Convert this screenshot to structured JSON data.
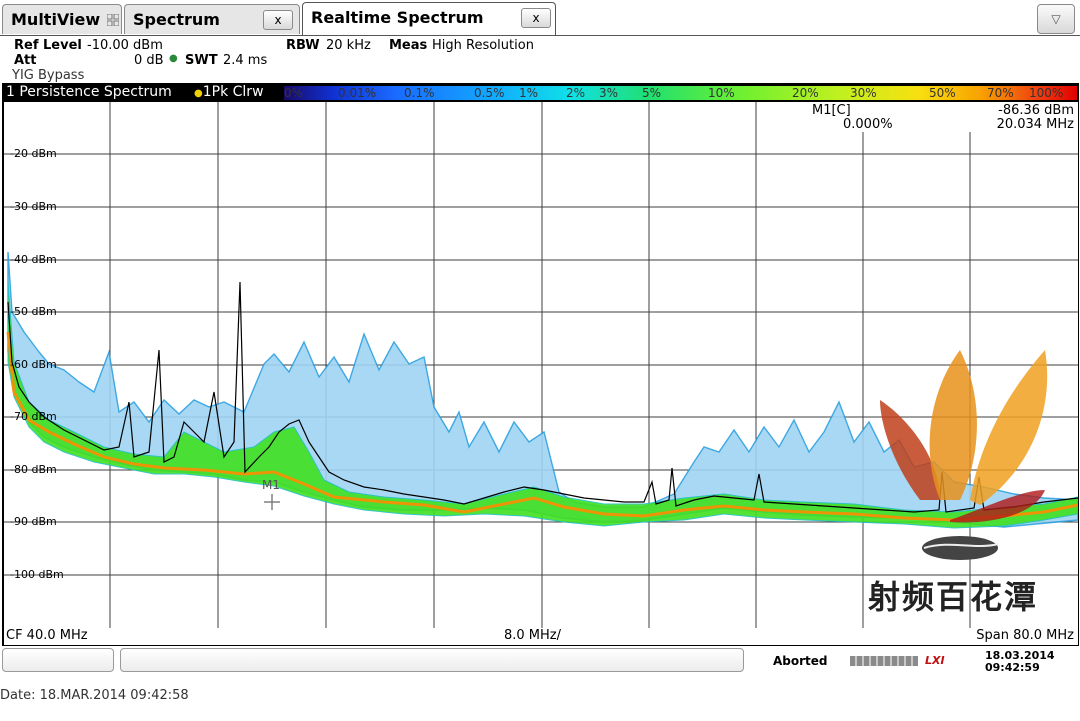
{
  "tabs": [
    {
      "label": "MultiView"
    },
    {
      "label": "Spectrum",
      "close": "x"
    },
    {
      "label": "Realtime Spectrum",
      "close": "x"
    }
  ],
  "settings": {
    "ref_level_label": "Ref Level",
    "ref_level_value": "-10.00 dBm",
    "att_label": "Att",
    "att_value": "0 dB",
    "swt_label": "SWT",
    "swt_value": "2.4 ms",
    "rbw_label": "RBW",
    "rbw_value": "20 kHz",
    "meas_label": "Meas",
    "meas_value": "High Resolution",
    "yig": "YIG Bypass"
  },
  "window": {
    "title": "1 Persistence Spectrum",
    "trace": "1Pk Clrw"
  },
  "colorbar_labels": [
    "0%",
    "0.01%",
    "0.1%",
    "0.5%",
    "1%",
    "2%",
    "3%",
    "5%",
    "10%",
    "20%",
    "30%",
    "50%",
    "70%",
    "100%"
  ],
  "y_axis_labels": [
    "-20 dBm",
    "-30 dBm",
    "-40 dBm",
    "-50 dBm",
    "-60 dBm",
    "-70 dBm",
    "-80 dBm",
    "-90 dBm",
    "-100 dBm"
  ],
  "marker": {
    "name": "M1[C]",
    "percent": "0.000%",
    "level": "-86.36 dBm",
    "freq": "20.034 MHz",
    "plot_label": "M1"
  },
  "footer": {
    "cf": "CF 40.0 MHz",
    "div": "8.0 MHz/",
    "span": "Span 80.0 MHz"
  },
  "status": {
    "aborted": "Aborted",
    "lxi": "LXI",
    "date": "18.03.2014",
    "time": "09:42:59"
  },
  "bottom": {
    "date_line": "Date: 18.MAR.2014  09:42:58"
  },
  "watermark": {
    "text": "射频百花潭"
  },
  "colors": {
    "trace": "#000000",
    "blue_band": "#2a9fe0",
    "green_band": "#40e020",
    "orange_band": "#ff8c00"
  }
}
